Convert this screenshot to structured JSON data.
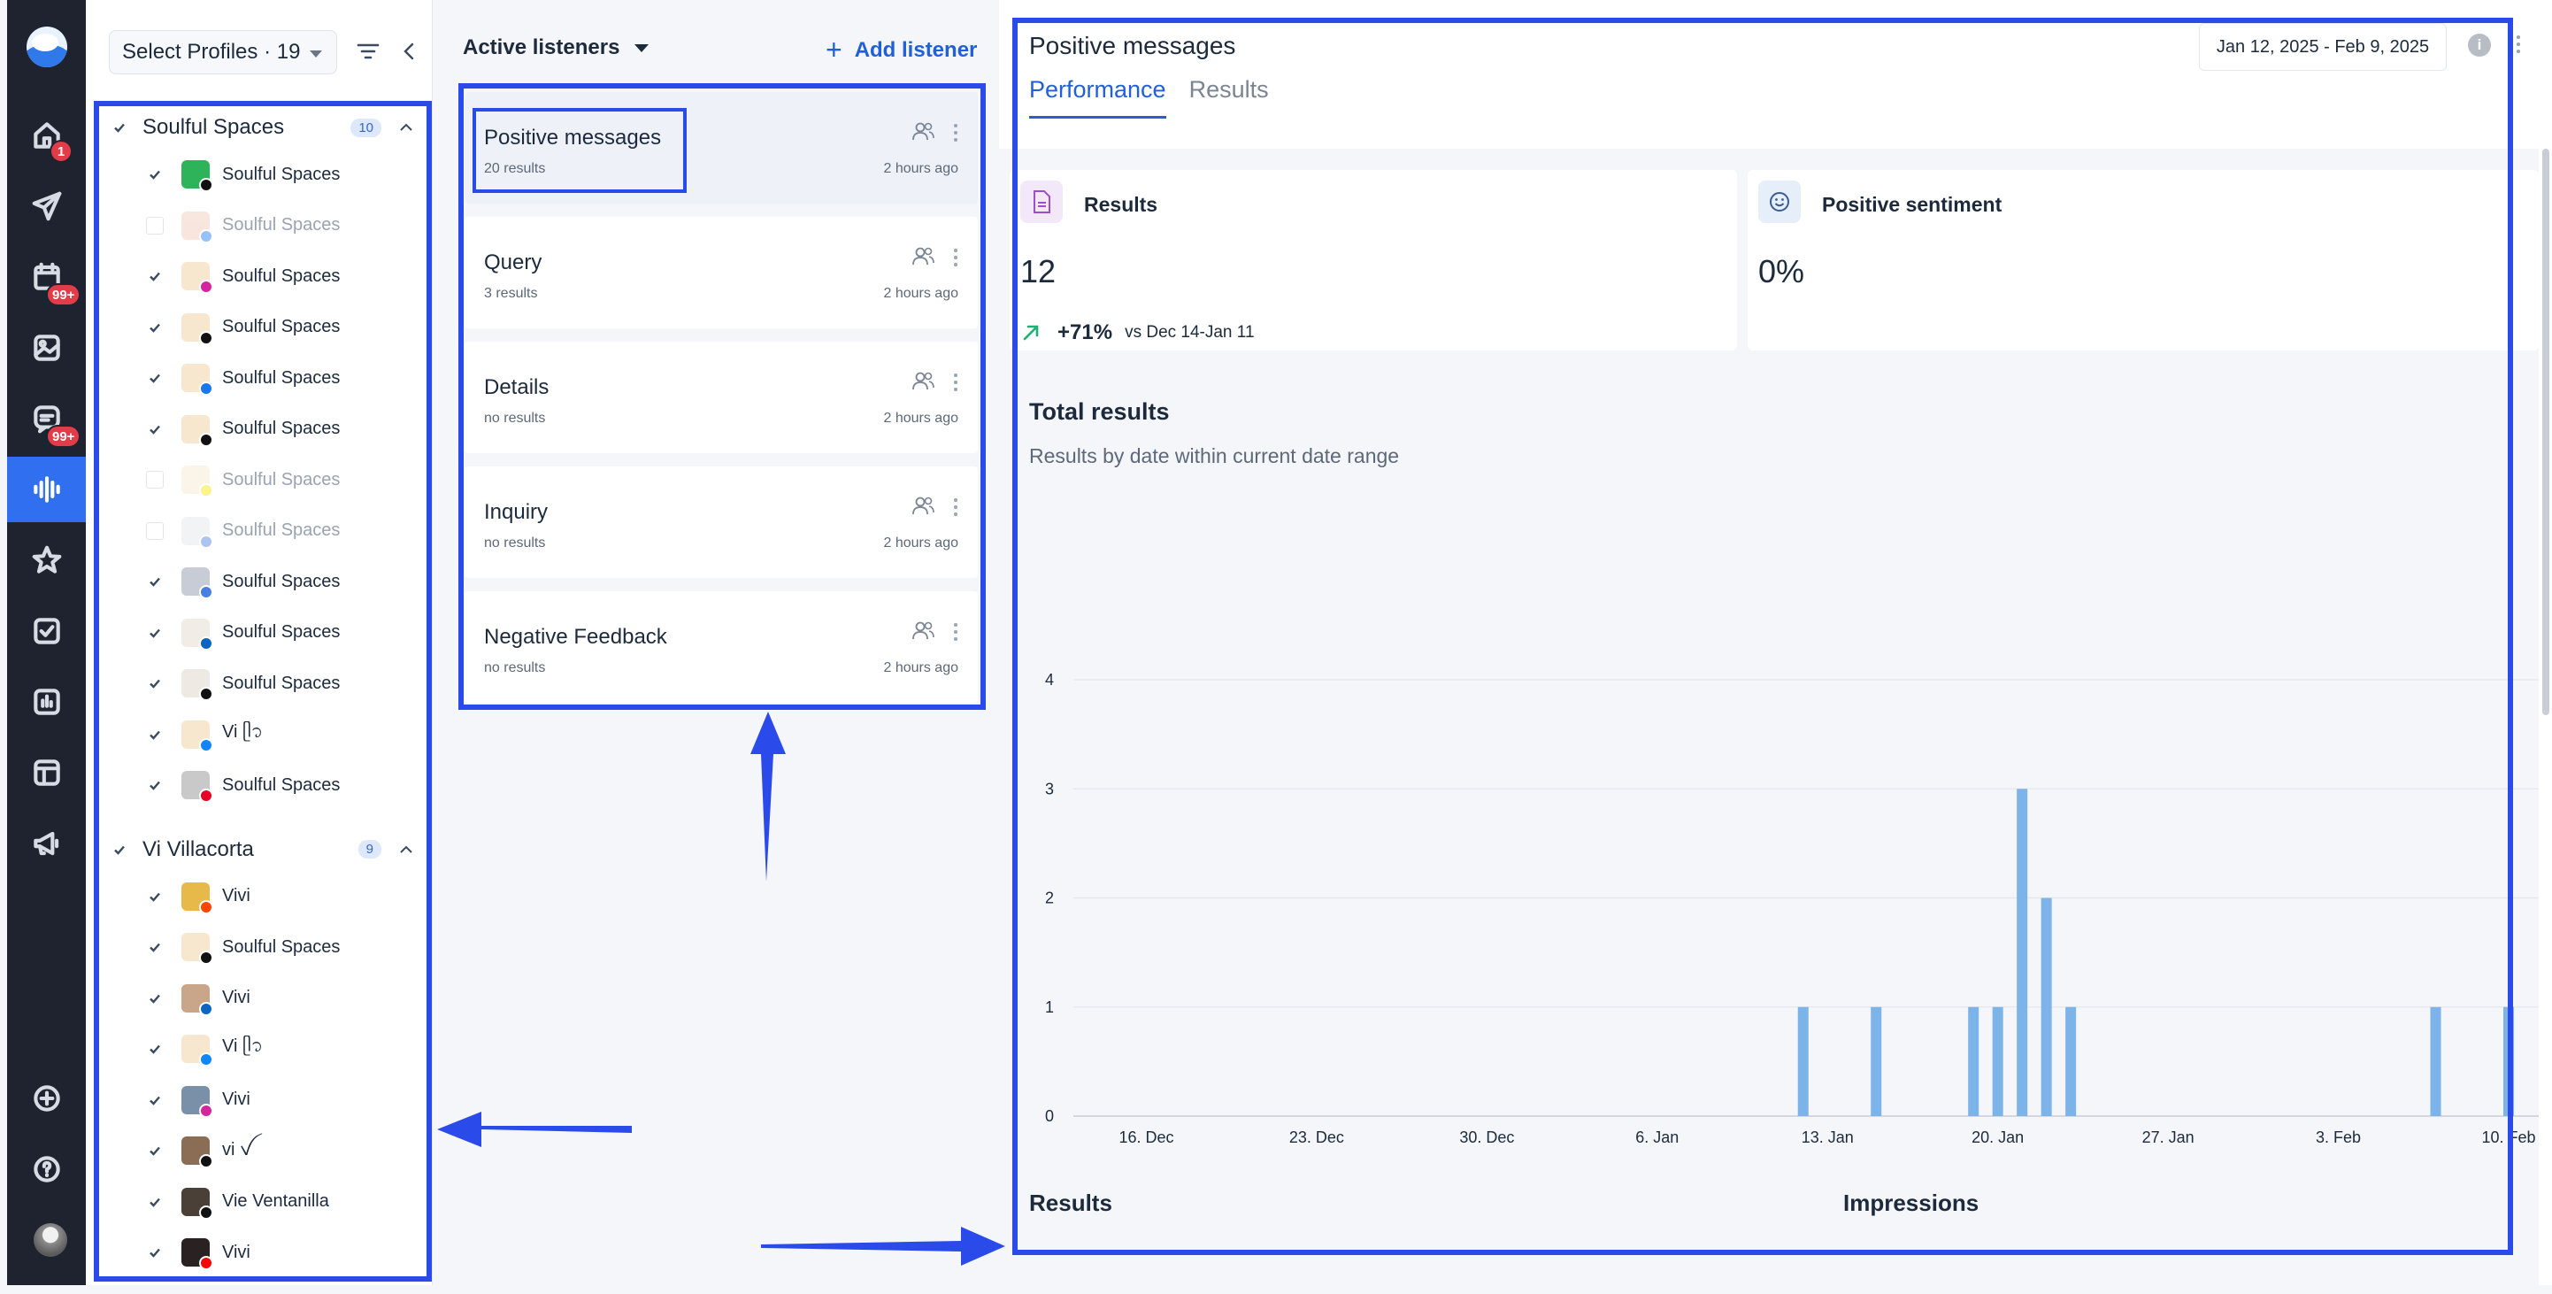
{
  "rail": {
    "badges": {
      "home": "1",
      "calendar": "99+",
      "inbox": "99+"
    },
    "icons": [
      "logo-icon",
      "home-icon",
      "send-icon",
      "calendar-icon",
      "media-icon",
      "inbox-icon",
      "listening-icon",
      "star-icon",
      "tasks-icon",
      "reports-icon",
      "layout-icon",
      "megaphone-icon",
      "add-icon",
      "help-icon",
      "avatar"
    ]
  },
  "profiles": {
    "select_label": "Select Profiles · 19",
    "groups": [
      {
        "name": "Soulful Spaces",
        "count": "10",
        "items": [
          {
            "name": "Soulful Spaces",
            "checked": true,
            "network": "threads",
            "avatar_color": "#2fb35a"
          },
          {
            "name": "Soulful Spaces",
            "checked": false,
            "network": "facebook",
            "avatar_color": "#f0c9b7"
          },
          {
            "name": "Soulful Spaces",
            "checked": true,
            "network": "instagram",
            "avatar_color": "#f8e7cf"
          },
          {
            "name": "Soulful Spaces",
            "checked": true,
            "network": "x",
            "avatar_color": "#f8e7cf"
          },
          {
            "name": "Soulful Spaces",
            "checked": true,
            "network": "facebook",
            "avatar_color": "#f8e7cf"
          },
          {
            "name": "Soulful Spaces",
            "checked": true,
            "network": "tiktok",
            "avatar_color": "#f8e7cf"
          },
          {
            "name": "Soulful Spaces",
            "checked": false,
            "network": "snapchat",
            "avatar_color": "#f8e7cf"
          },
          {
            "name": "Soulful Spaces",
            "checked": false,
            "network": "gbp",
            "avatar_color": "#e3e5ea"
          },
          {
            "name": "Soulful Spaces",
            "checked": true,
            "network": "gbp",
            "avatar_color": "#c8ccd6"
          },
          {
            "name": "Soulful Spaces",
            "checked": true,
            "network": "linkedin",
            "avatar_color": "#f1ede6"
          },
          {
            "name": "Soulful Spaces",
            "checked": true,
            "network": "threads",
            "avatar_color": "#efe9e4"
          },
          {
            "name": "Vi ᥫ᭡",
            "checked": true,
            "network": "bluesky",
            "avatar_color": "#f8e7cf"
          },
          {
            "name": "Soulful Spaces",
            "checked": true,
            "network": "pinterest",
            "avatar_color": "#c9c9c9"
          }
        ]
      },
      {
        "name": "Vi Villacorta",
        "count": "9",
        "items": [
          {
            "name": "Vivi",
            "checked": true,
            "network": "reddit",
            "avatar_color": "#e7b84a"
          },
          {
            "name": "Soulful Spaces",
            "checked": true,
            "network": "x",
            "avatar_color": "#f8e7cf"
          },
          {
            "name": "Vivi",
            "checked": true,
            "network": "linkedin",
            "avatar_color": "#c9a58a"
          },
          {
            "name": "Vi ᥫ᭡",
            "checked": true,
            "network": "bluesky",
            "avatar_color": "#f8e7cf"
          },
          {
            "name": "Vivi",
            "checked": true,
            "network": "instagram",
            "avatar_color": "#7a8fa8"
          },
          {
            "name": "vi ꪜ",
            "checked": true,
            "network": "tiktok",
            "avatar_color": "#8b6c55"
          },
          {
            "name": "Vie Ventanilla",
            "checked": true,
            "network": "x",
            "avatar_color": "#4a4038"
          },
          {
            "name": "Vivi",
            "checked": true,
            "network": "youtube",
            "avatar_color": "#2a2222"
          }
        ]
      }
    ]
  },
  "listeners": {
    "title": "Active listeners",
    "add_label": "Add listener",
    "items": [
      {
        "name": "Positive messages",
        "sub": "20 results",
        "time": "2 hours ago"
      },
      {
        "name": "Query",
        "sub": "3 results",
        "time": "2 hours ago"
      },
      {
        "name": "Details",
        "sub": "no results",
        "time": "2 hours ago"
      },
      {
        "name": "Inquiry",
        "sub": "no results",
        "time": "2 hours ago"
      },
      {
        "name": "Negative Feedback",
        "sub": "no results",
        "time": "2 hours ago"
      }
    ]
  },
  "detail": {
    "title": "Positive messages",
    "date_range": "Jan 12, 2025 - Feb 9, 2025",
    "tabs": [
      "Performance",
      "Results"
    ],
    "kpis": {
      "results_label": "Results",
      "results_value": "12",
      "results_delta": "+71%",
      "results_compare": "vs Dec 14-Jan 11",
      "sentiment_label": "Positive sentiment",
      "sentiment_value": "0%"
    },
    "total_title": "Total results",
    "total_sub": "Results by date within current date range",
    "bottom_results": "Results",
    "bottom_impressions": "Impressions"
  },
  "chart_data": {
    "type": "bar",
    "series": [
      {
        "name": "Results",
        "color": "#7cb3e8",
        "points": [
          {
            "x": "2025-01-12",
            "y": 1
          },
          {
            "x": "2025-01-15",
            "y": 1
          },
          {
            "x": "2025-01-19",
            "y": 1
          },
          {
            "x": "2025-01-20",
            "y": 1
          },
          {
            "x": "2025-01-21",
            "y": 3
          },
          {
            "x": "2025-01-22",
            "y": 2
          },
          {
            "x": "2025-01-23",
            "y": 1
          },
          {
            "x": "2025-02-07",
            "y": 1
          },
          {
            "x": "2025-02-10",
            "y": 1
          }
        ]
      }
    ],
    "x_ticks": [
      "16. Dec",
      "23. Dec",
      "30. Dec",
      "6. Jan",
      "13. Jan",
      "20. Jan",
      "27. Jan",
      "3. Feb",
      "10. Feb"
    ],
    "x_tick_dates": [
      "2024-12-16",
      "2024-12-23",
      "2024-12-30",
      "2025-01-06",
      "2025-01-13",
      "2025-01-20",
      "2025-01-27",
      "2025-02-03",
      "2025-02-10"
    ],
    "x_range": [
      "2024-12-13",
      "2025-02-10"
    ],
    "y_ticks": [
      0,
      1,
      2,
      3,
      4
    ],
    "ylim": [
      0,
      4
    ],
    "grid": true,
    "legend": "bottom-center"
  }
}
